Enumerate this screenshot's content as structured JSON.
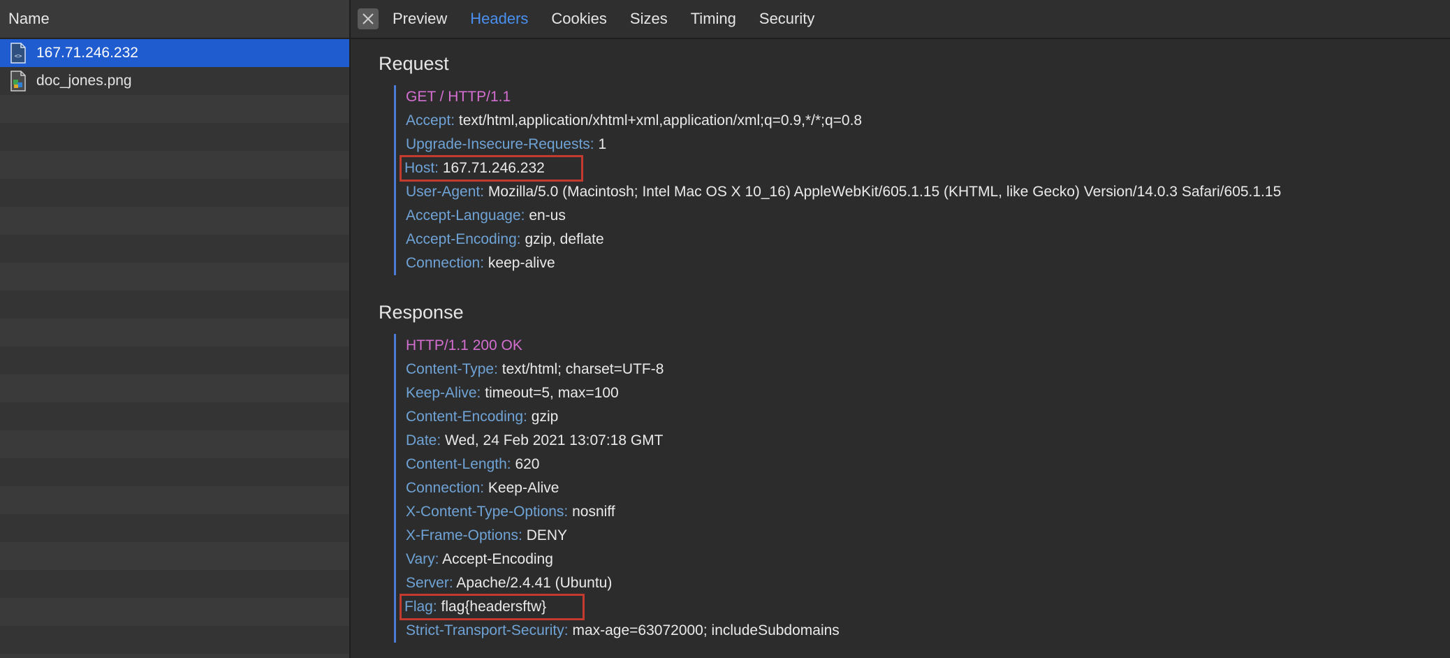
{
  "sidebar": {
    "header": "Name",
    "files": [
      {
        "name": "167.71.246.232",
        "icon": "html-document-icon",
        "selected": true
      },
      {
        "name": "doc_jones.png",
        "icon": "image-file-icon",
        "selected": false
      }
    ]
  },
  "tabs": {
    "close_icon": "close-icon",
    "items": [
      "Preview",
      "Headers",
      "Cookies",
      "Sizes",
      "Timing",
      "Security"
    ],
    "active": "Headers"
  },
  "request": {
    "title": "Request",
    "status": "GET / HTTP/1.1",
    "headers": [
      {
        "key": "Accept:",
        "value": "text/html,application/xhtml+xml,application/xml;q=0.9,*/*;q=0.8"
      },
      {
        "key": "Upgrade-Insecure-Requests:",
        "value": "1"
      },
      {
        "key": "Host:",
        "value": "167.71.246.232",
        "highlighted": true
      },
      {
        "key": "User-Agent:",
        "value": "Mozilla/5.0 (Macintosh; Intel Mac OS X 10_16) AppleWebKit/605.1.15 (KHTML, like Gecko) Version/14.0.3 Safari/605.1.15"
      },
      {
        "key": "Accept-Language:",
        "value": "en-us"
      },
      {
        "key": "Accept-Encoding:",
        "value": "gzip, deflate"
      },
      {
        "key": "Connection:",
        "value": "keep-alive"
      }
    ]
  },
  "response": {
    "title": "Response",
    "status": "HTTP/1.1 200 OK",
    "headers": [
      {
        "key": "Content-Type:",
        "value": "text/html; charset=UTF-8"
      },
      {
        "key": "Keep-Alive:",
        "value": "timeout=5, max=100"
      },
      {
        "key": "Content-Encoding:",
        "value": "gzip"
      },
      {
        "key": "Date:",
        "value": "Wed, 24 Feb 2021 13:07:18 GMT"
      },
      {
        "key": "Content-Length:",
        "value": "620"
      },
      {
        "key": "Connection:",
        "value": "Keep-Alive"
      },
      {
        "key": "X-Content-Type-Options:",
        "value": "nosniff"
      },
      {
        "key": "X-Frame-Options:",
        "value": "DENY"
      },
      {
        "key": "Vary:",
        "value": "Accept-Encoding"
      },
      {
        "key": "Server:",
        "value": "Apache/2.4.41 (Ubuntu)"
      },
      {
        "key": "Flag:",
        "value": "flag{headersftw}",
        "highlighted": true
      },
      {
        "key": "Strict-Transport-Security:",
        "value": "max-age=63072000; includeSubdomains"
      }
    ]
  },
  "colors": {
    "accent": "#4a90f0",
    "selection": "#1f5ccf",
    "header_key": "#6fa3d6",
    "status_line": "#d46fd1",
    "highlight_box": "#c33a2e"
  }
}
